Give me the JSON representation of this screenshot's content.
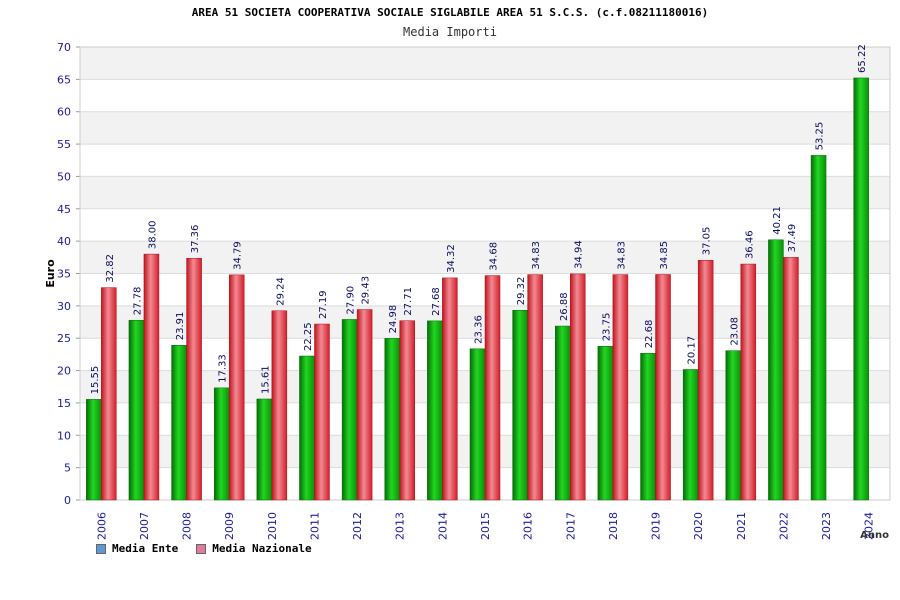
{
  "chart_data": {
    "type": "bar",
    "title": "AREA 51 SOCIETA COOPERATIVA SOCIALE SIGLABILE AREA 51 S.C.S. (c.f.08211180016)",
    "subtitle": "Media Importi",
    "xlabel": "Anno",
    "ylabel": "Euro",
    "ylim": [
      0,
      70
    ],
    "yticks": [
      0,
      5,
      10,
      15,
      20,
      25,
      30,
      35,
      40,
      45,
      50,
      55,
      60,
      65,
      70
    ],
    "grid": true,
    "legend_position": "bottom-left",
    "categories": [
      "2006",
      "2007",
      "2008",
      "2009",
      "2010",
      "2011",
      "2012",
      "2013",
      "2014",
      "2015",
      "2016",
      "2017",
      "2018",
      "2019",
      "2020",
      "2021",
      "2022",
      "2023",
      "2024"
    ],
    "series": [
      {
        "name": "Media Ente",
        "legend_color": "#5b9bd5",
        "bar_color": "#0fb40f",
        "values": [
          15.55,
          27.78,
          23.91,
          17.33,
          15.61,
          22.25,
          27.9,
          24.98,
          27.68,
          23.36,
          29.32,
          26.88,
          23.75,
          22.68,
          20.17,
          23.08,
          40.21,
          53.25,
          65.22
        ],
        "labels": [
          "15.55",
          "27.78",
          "23.91",
          "17.33",
          "15.61",
          "22.25",
          "27.90",
          "24.98",
          "27.68",
          "23.36",
          "29.32",
          "26.88",
          "23.75",
          "22.68",
          "20.17",
          "23.08",
          "40.21",
          "53.25",
          "65.22"
        ]
      },
      {
        "name": "Media Nazionale",
        "legend_color": "#e07aa0",
        "bar_color": "#e8333d",
        "values": [
          32.82,
          38.0,
          37.36,
          34.79,
          29.24,
          27.19,
          29.43,
          27.71,
          34.32,
          34.68,
          34.83,
          34.94,
          34.83,
          34.85,
          37.05,
          36.46,
          37.49,
          null,
          null
        ],
        "labels": [
          "32.82",
          "38.00",
          "37.36",
          "34.79",
          "29.24",
          "27.19",
          "29.43",
          "27.71",
          "34.32",
          "34.68",
          "34.83",
          "34.94",
          "34.83",
          "34.85",
          "37.05",
          "36.46",
          "37.49",
          null,
          null
        ]
      }
    ]
  }
}
